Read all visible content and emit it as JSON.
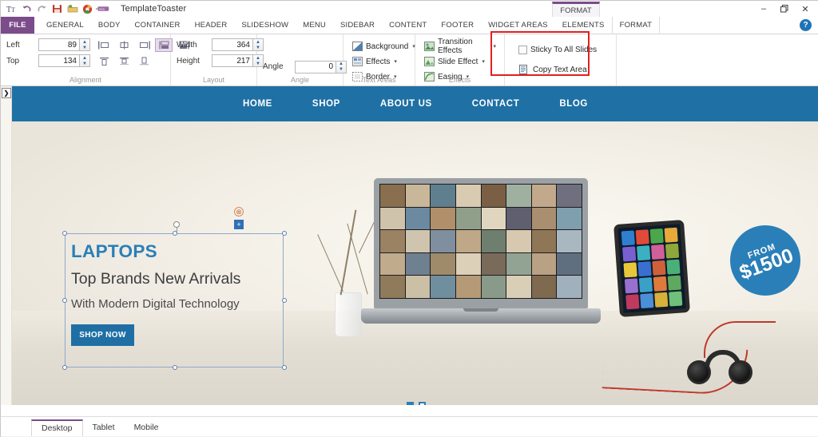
{
  "window": {
    "app_title": "TemplateToaster",
    "minimize": "–",
    "restore": "❐",
    "close": "✕",
    "help": "?"
  },
  "quick_access": {
    "items": [
      {
        "name": "text-tool-icon",
        "glyph": "Tт"
      },
      {
        "name": "undo-icon",
        "glyph": "↶"
      },
      {
        "name": "redo-icon",
        "glyph": "↷"
      },
      {
        "name": "save-icon",
        "glyph": "Ὃe"
      },
      {
        "name": "open-folder-icon",
        "glyph": "▰"
      },
      {
        "name": "preview-browser-icon",
        "glyph": "●"
      },
      {
        "name": "woocommerce-icon",
        "glyph": "woo"
      }
    ]
  },
  "ribbon": {
    "contextual_tab": "FORMAT",
    "tabs": [
      "FILE",
      "GENERAL",
      "BODY",
      "CONTAINER",
      "HEADER",
      "SLIDESHOW",
      "MENU",
      "SIDEBAR",
      "CONTENT",
      "FOOTER",
      "WIDGET AREAS",
      "ELEMENTS",
      "FORMAT"
    ],
    "active_tab": "FORMAT",
    "groups": {
      "alignment": {
        "label": "Alignment",
        "left_label": "Left",
        "left_value": "89",
        "top_label": "Top",
        "top_value": "134",
        "buttons_row1": [
          "align-left-icon",
          "align-center-icon",
          "align-right-icon",
          "distribute-horizontal-icon",
          "align-edge-icon"
        ],
        "buttons_row2": [
          "align-top-icon",
          "align-middle-icon",
          "align-bottom-icon"
        ],
        "selected_button": "distribute-horizontal-icon"
      },
      "layout": {
        "label": "Layout",
        "width_label": "Width",
        "width_value": "364",
        "height_label": "Height",
        "height_value": "217"
      },
      "angle": {
        "label": "Angle",
        "angle_label": "Angle",
        "angle_value": "0"
      },
      "text_areas": {
        "label": "Text Areas",
        "items": [
          {
            "label": "Background",
            "icon": "background-fill-icon",
            "has_caret": true
          },
          {
            "label": "Effects",
            "icon": "effects-icon",
            "has_caret": true
          },
          {
            "label": "Border",
            "icon": "border-icon",
            "has_caret": true
          }
        ]
      },
      "effects": {
        "label": "Effects",
        "items": [
          {
            "label": "Transition Effects",
            "icon": "transition-effects-icon",
            "has_caret": true
          },
          {
            "label": "Slide Effect",
            "icon": "slide-effect-icon",
            "has_caret": true
          },
          {
            "label": "Easing",
            "icon": "easing-icon",
            "has_caret": true
          }
        ]
      },
      "slide_options": {
        "sticky_label": "Sticky To All Slides",
        "sticky_checked": false,
        "copy_label": "Copy Text Area",
        "copy_icon": "copy-text-area-icon",
        "highlight_color": "#e02020"
      }
    }
  },
  "canvas": {
    "panel_toggle": "❯",
    "nav": {
      "background": "#1f70a4",
      "links": [
        "HOME",
        "SHOP",
        "ABOUT US",
        "CONTACT",
        "BLOG"
      ]
    },
    "slide": {
      "text_area": {
        "title": "LAPTOPS",
        "title_color": "#2a7fb8",
        "heading": "Top Brands New Arrivals",
        "subheading": "With Modern Digital Technology",
        "button_label": "SHOP NOW",
        "button_color": "#1f6fa5"
      },
      "price_badge": {
        "from_label": "FROM",
        "price": "$1500",
        "color": "#2a7fb8"
      },
      "pagination": {
        "total": 2,
        "active_index": 0
      },
      "scroll_top_icon": "chevron-double-up-icon"
    }
  },
  "bottom": {
    "device_tabs": [
      "Desktop",
      "Tablet",
      "Mobile"
    ],
    "active_device": "Desktop"
  }
}
